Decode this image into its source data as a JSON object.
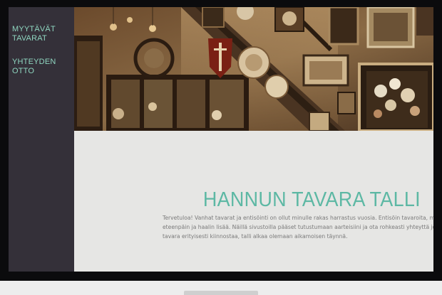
{
  "sidebar": {
    "items": [
      {
        "label_line1": "MYYTÄVÄT",
        "label_line2": "TAVARAT"
      },
      {
        "label_line1": "YHTEYDEN",
        "label_line2": "OTTO"
      }
    ]
  },
  "main": {
    "title": "HANNUN TAVARA TALLI",
    "intro_lines": [
      "Tervetuloa! Vanhat tavarat ja entisöinti on ollut minulle rakas harrastus vuosia. Entisöin tavaroita, myyn",
      "eteenpäin ja haalin lisää. Näillä sivustoilla pääset tutustumaan aarteisiini ja ota rohkeasti yhteyttä jos jo",
      "tavara erityisesti kiinnostaa, talli alkaa olemaan aikamoisen täynnä."
    ]
  },
  "colors": {
    "sidebar_bg": "#343039",
    "nav_text": "#8fd6c0",
    "title": "#5db8a4",
    "content_bg": "#e6e6e4",
    "body_text": "#7a7a7a"
  }
}
